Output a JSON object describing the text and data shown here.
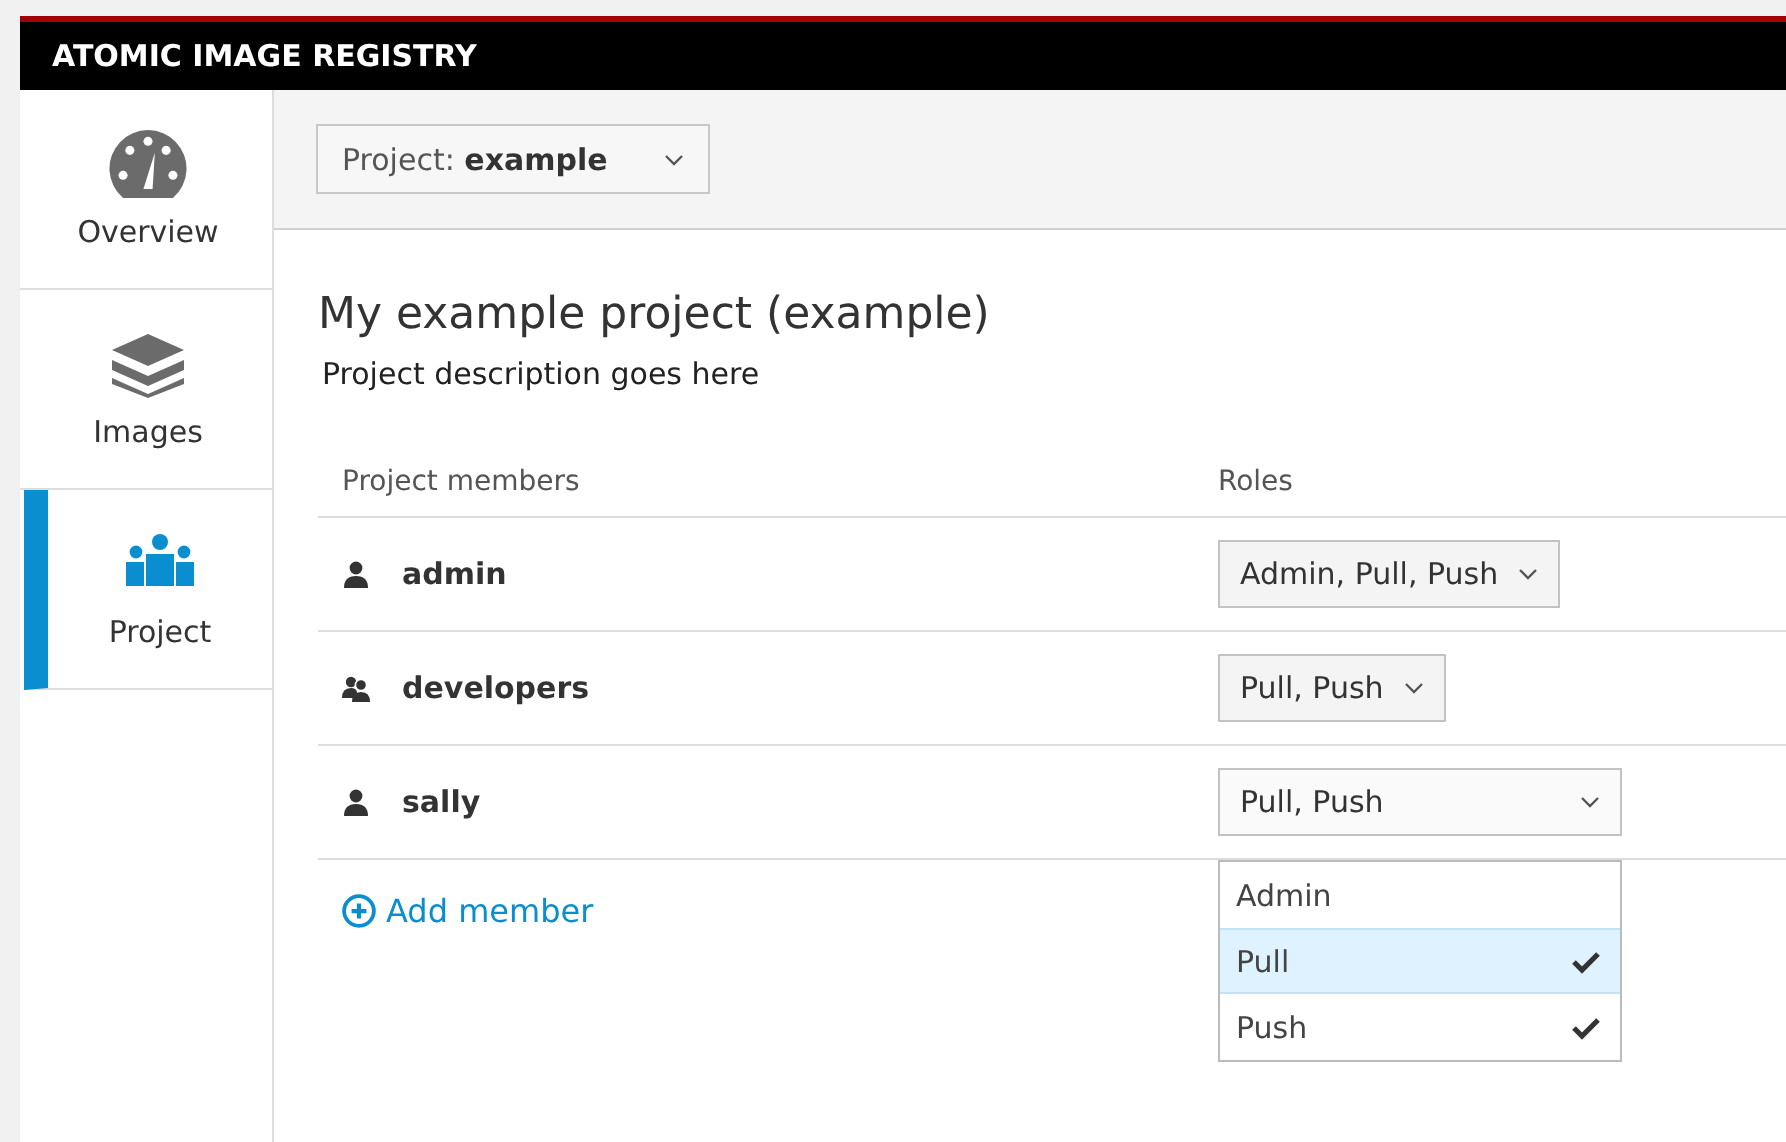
{
  "header": {
    "title": "ATOMIC IMAGE REGISTRY"
  },
  "sidebar": {
    "items": [
      {
        "label": "Overview",
        "kind": "gauge",
        "selected": false
      },
      {
        "label": "Images",
        "kind": "layers",
        "selected": false
      },
      {
        "label": "Project",
        "kind": "people",
        "selected": true
      }
    ]
  },
  "toolbar": {
    "project_select": {
      "label": "Project:",
      "value": "example"
    }
  },
  "project": {
    "title": "My example project (example)",
    "description": "Project description goes here"
  },
  "members_table": {
    "columns": [
      "Project members",
      "Roles"
    ],
    "rows": [
      {
        "kind": "user",
        "name": "admin",
        "roles": "Admin, Pull, Push",
        "expanded": false
      },
      {
        "kind": "group",
        "name": "developers",
        "roles": "Pull, Push",
        "expanded": false
      },
      {
        "kind": "user",
        "name": "sally",
        "roles": "Pull, Push",
        "expanded": true,
        "options": [
          {
            "label": "Admin",
            "checked": false,
            "highlighted": false
          },
          {
            "label": "Pull",
            "checked": true,
            "highlighted": true
          },
          {
            "label": "Push",
            "checked": true,
            "highlighted": false
          }
        ]
      }
    ]
  },
  "add_member": {
    "label": "Add member"
  }
}
